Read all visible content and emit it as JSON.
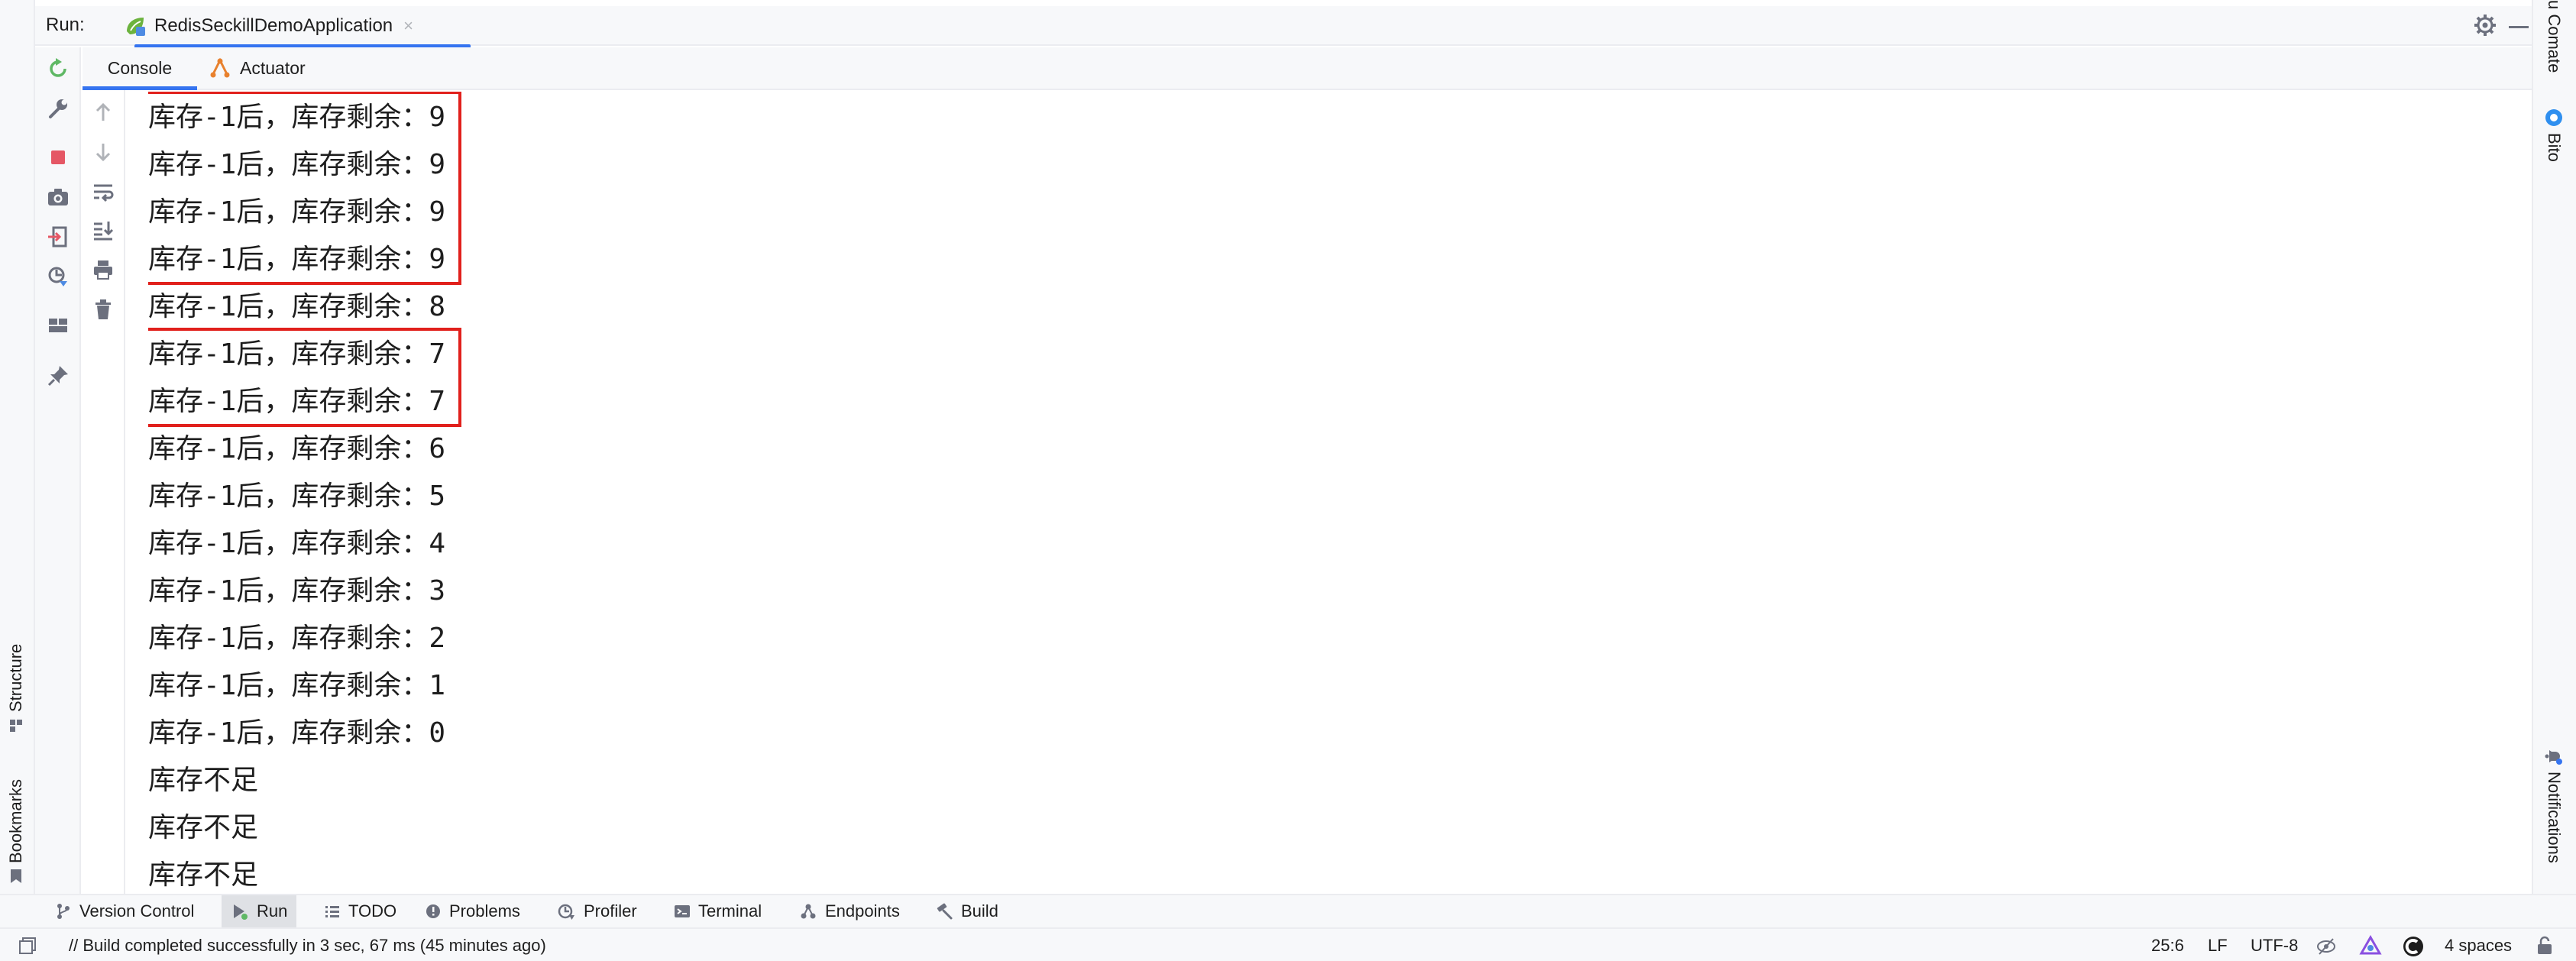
{
  "run_bar": {
    "label": "Run:",
    "config_name": "RedisSeckillDemoApplication",
    "close_glyph": "×"
  },
  "sub_tabs": [
    {
      "label": "Console",
      "active": true
    },
    {
      "label": "Actuator",
      "active": false
    }
  ],
  "left_strip": {
    "structure": "Structure",
    "bookmarks": "Bookmarks"
  },
  "right_strip": {
    "comate": "u Comate",
    "bito": "Bito",
    "notifications": "Notifications"
  },
  "console": {
    "lines": [
      "库存-1后，库存剩余：9",
      "库存-1后，库存剩余：9",
      "库存-1后，库存剩余：9",
      "库存-1后，库存剩余：9",
      "库存-1后，库存剩余：8",
      "库存-1后，库存剩余：7",
      "库存-1后，库存剩余：7",
      "库存-1后，库存剩余：6",
      "库存-1后，库存剩余：5",
      "库存-1后，库存剩余：4",
      "库存-1后，库存剩余：3",
      "库存-1后，库存剩余：2",
      "库存-1后，库存剩余：1",
      "库存-1后，库存剩余：0",
      "库存不足",
      "库存不足",
      "库存不足"
    ],
    "highlight_color": "#e1201c"
  },
  "tool_windows": [
    {
      "label": "Version Control",
      "icon": "branch-icon",
      "active": false
    },
    {
      "label": "Run",
      "icon": "run-icon",
      "active": true
    },
    {
      "label": "TODO",
      "icon": "list-icon",
      "active": false
    },
    {
      "label": "Problems",
      "icon": "warning-icon",
      "active": false
    },
    {
      "label": "Profiler",
      "icon": "profiler-icon",
      "active": false
    },
    {
      "label": "Terminal",
      "icon": "terminal-icon",
      "active": false
    },
    {
      "label": "Endpoints",
      "icon": "endpoints-icon",
      "active": false
    },
    {
      "label": "Build",
      "icon": "hammer-icon",
      "active": false
    }
  ],
  "status_bar": {
    "message": "// Build completed successfully in 3 sec, 67 ms (45 minutes ago)",
    "position": "25:6",
    "line_separator": "LF",
    "encoding": "UTF-8",
    "indent": "4 spaces"
  },
  "colors": {
    "accent": "#3574f0",
    "stop": "#e55765",
    "rerun": "#5fb865"
  }
}
